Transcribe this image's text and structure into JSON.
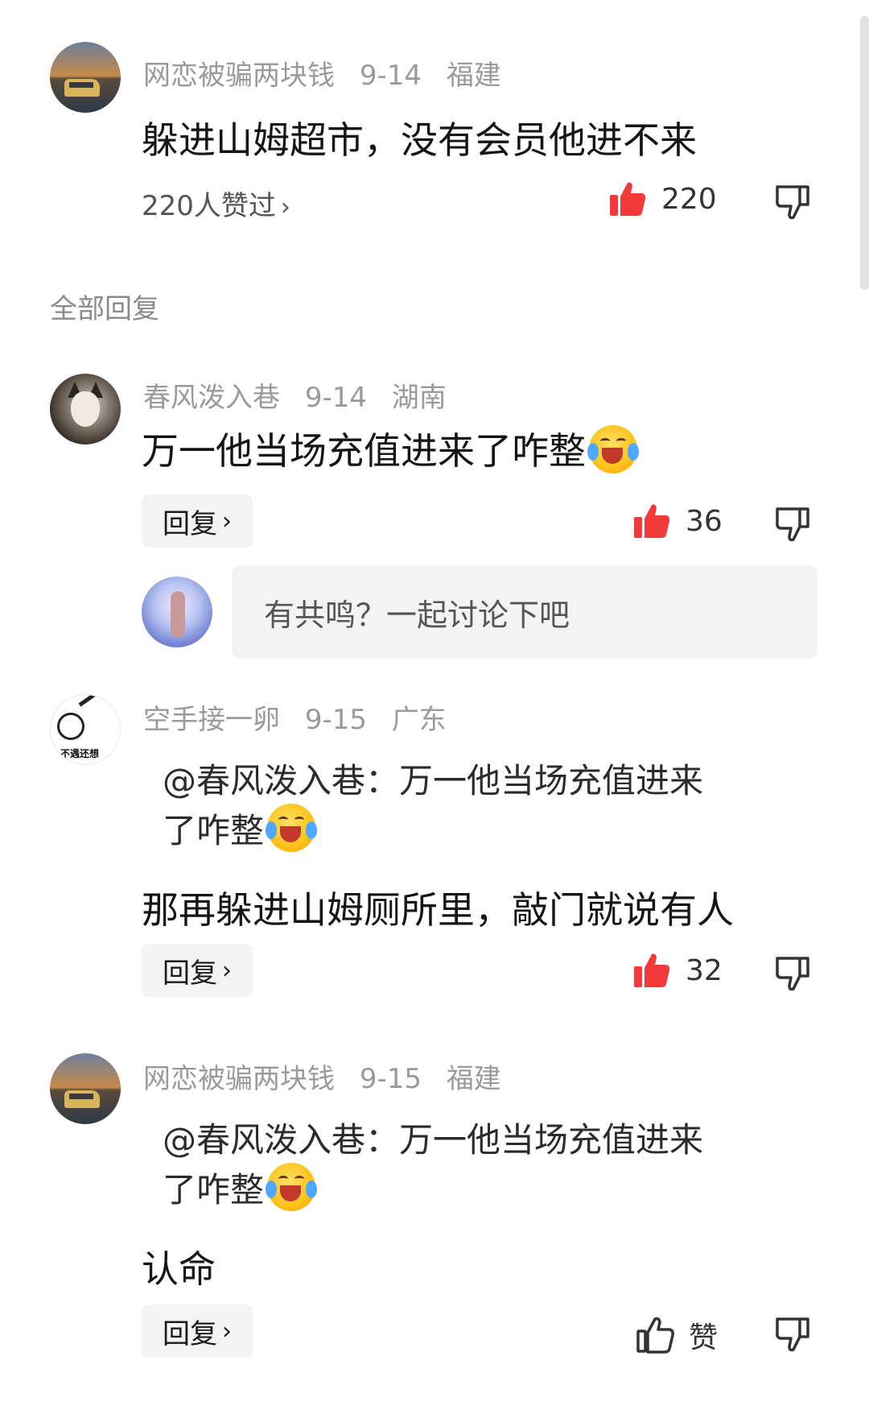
{
  "main_comment": {
    "user": "网恋被骗两块钱",
    "date": "9-14",
    "location": "福建",
    "text": "躲进山姆超市，没有会员他进不来",
    "liked_by": "220人赞过",
    "likes": "220",
    "liked": true
  },
  "section_title": "全部回复",
  "replies": [
    {
      "user": "春风泼入巷",
      "date": "9-14",
      "location": "湖南",
      "text": "万一他当场充值进来了咋整",
      "emoji": "laughing-crying-emoji",
      "reply_label": "回复",
      "likes": "36",
      "liked": true
    },
    {
      "user": "空手接一卵",
      "date": "9-15",
      "location": "广东",
      "quote_line1": "@春风泼入巷：万一他当场充值进来",
      "quote_line2": "了咋整",
      "text": "那再躲进山姆厕所里，敲门就说有人",
      "reply_label": "回复",
      "likes": "32",
      "liked": true
    },
    {
      "user": "网恋被骗两块钱",
      "date": "9-15",
      "location": "福建",
      "quote_line1": "@春风泼入巷：万一他当场充值进来",
      "quote_line2": "了咋整",
      "text": "认命",
      "reply_label": "回复",
      "likes": "赞",
      "liked": false
    }
  ],
  "discussion_placeholder": "有共鸣？一起讨论下吧",
  "avatar_meme_text": "不遇还想",
  "colors": {
    "like_red": "#f23a3a",
    "meta_gray": "#9a9a9a",
    "button_bg": "#f3f3f3"
  }
}
